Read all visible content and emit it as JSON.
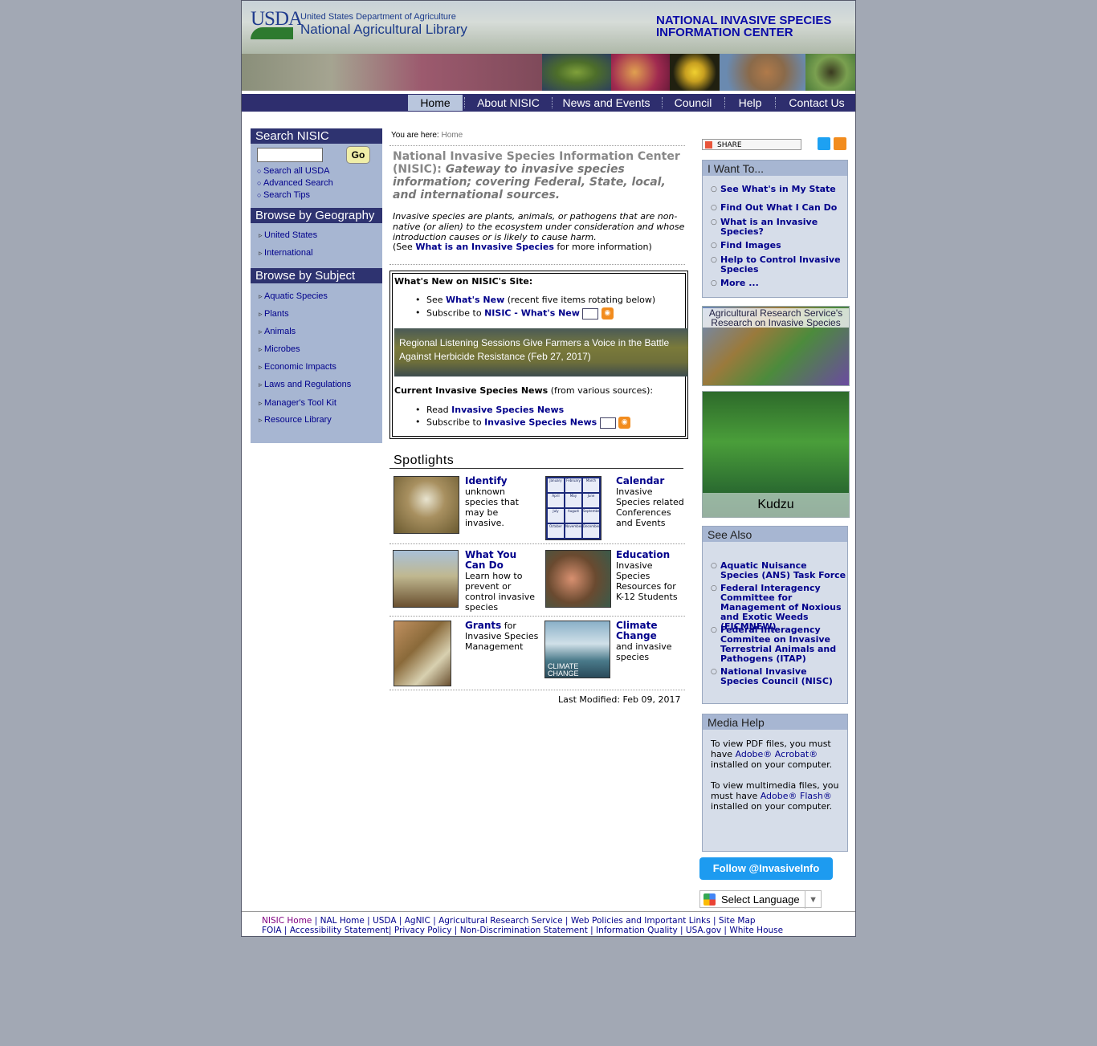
{
  "header": {
    "usda": "USDA",
    "dept": "United States Department of Agriculture",
    "library": "National Agricultural Library",
    "title_line1": "NATIONAL INVASIVE SPECIES",
    "title_line2": "INFORMATION CENTER"
  },
  "nav": {
    "items": [
      "Home",
      "About NISIC",
      "News and Events",
      "Council",
      "Help",
      "Contact Us"
    ],
    "active": "Home"
  },
  "left": {
    "search_heading": "Search NISIC",
    "go_label": "Go",
    "search_links": [
      "Search all USDA",
      "Advanced Search",
      "Search Tips"
    ],
    "geo_heading": "Browse by Geography",
    "geo_items": [
      "United States",
      "International"
    ],
    "subject_heading": "Browse by Subject",
    "subject_items": [
      "Aquatic Species",
      "Plants",
      "Animals",
      "Microbes",
      "Economic Impacts",
      "Laws and Regulations",
      "Manager's Tool Kit",
      "Resource Library"
    ]
  },
  "main": {
    "crumb_label": "You are here:",
    "crumb_current": "Home",
    "title_plain": "National Invasive Species Information Center (NISIC):",
    "title_italic": "Gateway to invasive species information; covering Federal, State, local, and international sources.",
    "description": "Invasive species are plants, animals, or pathogens that are non-native (or alien) to the ecosystem under consideration and whose introduction causes or is likely to cause harm.",
    "see_prefix": "(See",
    "see_link": "What is an Invasive Species",
    "see_suffix": "for more information)",
    "whats_new_heading": "What's New on NISIC's Site:",
    "wn_see": "See",
    "wn_link": "What's New",
    "wn_suffix": "(recent five items rotating below)",
    "wn_sub_prefix": "Subscribe to",
    "wn_sub_link": "NISIC - What's New",
    "rotating_item": "Regional Listening Sessions Give Farmers a Voice in the Battle Against Herbicide Resistance (Feb 27, 2017)",
    "current_heading": "Current Invasive Species News",
    "current_suffix": "(from various sources):",
    "read_prefix": "Read",
    "read_link": "Invasive Species News",
    "sub2_prefix": "Subscribe to",
    "sub2_link": "Invasive Species News",
    "spotlights_heading": "Spotlights",
    "spotlights": [
      {
        "title": "Identify",
        "text": "unknown species that may be invasive."
      },
      {
        "title": "Calendar",
        "text": "Invasive Species related Conferences and Events"
      },
      {
        "title": "What You Can Do",
        "text": "Learn how to prevent or control invasive species"
      },
      {
        "title": "Education",
        "text": "Invasive Species Resources for K-12 Students"
      },
      {
        "title": "Grants",
        "text": "for Invasive Species Management"
      },
      {
        "title": "Climate Change",
        "text": "and invasive species"
      }
    ],
    "calendar_months": [
      "January",
      "February",
      "March",
      "April",
      "May",
      "June",
      "July",
      "August",
      "September",
      "October",
      "November",
      "December"
    ],
    "climate_img_text": "CLIMATE CHANGE",
    "last_modified": "Last Modified: Feb 09, 2017"
  },
  "right": {
    "share_label": "SHARE",
    "iwant_heading": "I Want To...",
    "iwant_items": [
      "See What's in My State",
      "Find Out What I Can Do",
      "What is an Invasive Species?",
      "Find Images",
      "Help to Control Invasive Species",
      "More ..."
    ],
    "ars_title": "Agricultural Research Service's Research on Invasive Species",
    "kudzu_label": "Kudzu",
    "seealso_heading": "See Also",
    "seealso_items": [
      "Aquatic Nuisance Species (ANS) Task Force",
      "Federal Interagency Committee for Management of Noxious and Exotic Weeds (FICMNEW)",
      "Federal Interagency Commitee on Invasive Terrestrial Animals and Pathogens (ITAP)",
      "National Invasive Species Council (NISC)"
    ],
    "media_heading": "Media Help",
    "media_p1_prefix": "To view PDF files, you must have",
    "media_p1_link": "Adobe® Acrobat®",
    "media_p1_suffix": "installed on your computer.",
    "media_p2_prefix": "To view multimedia files, you must have",
    "media_p2_link": "Adobe® Flash®",
    "media_p2_suffix": "installed on your computer.",
    "follow_label": "Follow @InvasiveInfo",
    "language_label": "Select Language"
  },
  "footer": {
    "row1": [
      "NISIC Home",
      "NAL Home",
      "USDA",
      "AgNIC",
      "Agricultural Research Service",
      "Web Policies and Important Links",
      "Site Map"
    ],
    "row2": [
      "FOIA",
      "Accessibility Statement",
      "Privacy Policy",
      "Non-Discrimination Statement",
      "Information Quality",
      "USA.gov",
      "White House"
    ]
  },
  "colors": {
    "nav_bg": "#2e2e6e",
    "sidebar_bg": "#a7b6d2",
    "link": "#00008b",
    "page_bg": "#a2a8b4"
  }
}
